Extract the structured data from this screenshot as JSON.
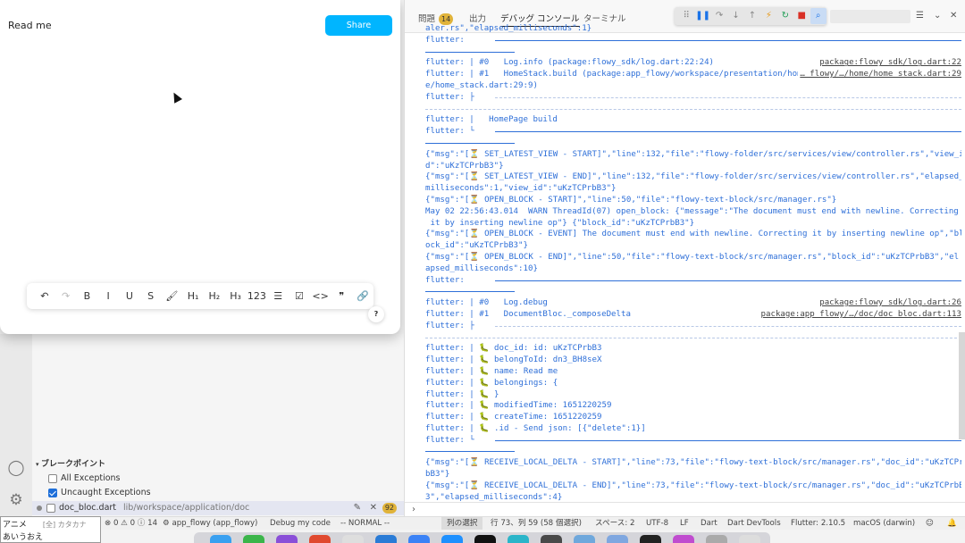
{
  "app_window": {
    "doc_title": "Read me",
    "share_label": "Share",
    "toolbar": {
      "buttons": [
        {
          "name": "undo",
          "glyph": "↶",
          "dim": false
        },
        {
          "name": "redo",
          "glyph": "↷",
          "dim": true
        },
        {
          "name": "bold",
          "glyph": "B",
          "dim": false
        },
        {
          "name": "italic",
          "glyph": "I",
          "dim": false
        },
        {
          "name": "underline",
          "glyph": "U",
          "dim": false
        },
        {
          "name": "strikethrough",
          "glyph": "S",
          "dim": false
        },
        {
          "name": "highlight",
          "glyph": "🖌",
          "dim": false
        },
        {
          "name": "h1",
          "glyph": "H₁",
          "dim": false
        },
        {
          "name": "h2",
          "glyph": "H₂",
          "dim": false
        },
        {
          "name": "h3",
          "glyph": "H₃",
          "dim": false
        },
        {
          "name": "numbered-list",
          "glyph": "123",
          "dim": false
        },
        {
          "name": "bullet-list",
          "glyph": "☰",
          "dim": false
        },
        {
          "name": "checkbox",
          "glyph": "☑",
          "dim": false
        },
        {
          "name": "code",
          "glyph": "<>",
          "dim": false
        },
        {
          "name": "quote",
          "glyph": "❞",
          "dim": false
        },
        {
          "name": "link",
          "glyph": "🔗",
          "dim": true
        }
      ]
    },
    "help_label": "?"
  },
  "panel": {
    "tabs": [
      {
        "label": "問題",
        "active": false
      },
      {
        "label": "出力",
        "active": false
      },
      {
        "label": "デバッグ コンソール",
        "active": true
      },
      {
        "label": "ターミナル",
        "active": false
      }
    ],
    "problems_count": "14",
    "log_lines": [
      {
        "kind": "text",
        "text": "aler.rs\",\"elapsed_milliseconds\":1}"
      },
      {
        "kind": "rule-full",
        "text": "flutter: "
      },
      {
        "kind": "rule-short",
        "text": ""
      },
      {
        "kind": "frame",
        "text": "flutter: | #0   Log.info (package:flowy_sdk/log.dart:22:24)",
        "link": "package:flowy_sdk/log.dart:22"
      },
      {
        "kind": "frame",
        "text": "flutter: | #1   HomeStack.build (package:app_flowy/workspace/presentation/hom",
        "link": "…_flowy/…/home/home_stack.dart:29"
      },
      {
        "kind": "text",
        "text": "e/home_stack.dart:29:9)"
      },
      {
        "kind": "dash",
        "text": "flutter: ├"
      },
      {
        "kind": "dash-only",
        "text": ""
      },
      {
        "kind": "text",
        "text": "flutter: |   HomePage build"
      },
      {
        "kind": "rule-full",
        "text": "flutter: └"
      },
      {
        "kind": "rule-short",
        "text": ""
      },
      {
        "kind": "text",
        "text": "{\"msg\":\"[⏳ SET_LATEST_VIEW - START]\",\"line\":132,\"file\":\"flowy-folder/src/services/view/controller.rs\",\"view_i"
      },
      {
        "kind": "text",
        "text": "d\":\"uKzTCPrbB3\"}"
      },
      {
        "kind": "text",
        "text": "{\"msg\":\"[⏳ SET_LATEST_VIEW - END]\",\"line\":132,\"file\":\"flowy-folder/src/services/view/controller.rs\",\"elapsed_"
      },
      {
        "kind": "text",
        "text": "milliseconds\":1,\"view_id\":\"uKzTCPrbB3\"}"
      },
      {
        "kind": "text",
        "text": "{\"msg\":\"[⏳ OPEN_BLOCK - START]\",\"line\":50,\"file\":\"flowy-text-block/src/manager.rs\"}"
      },
      {
        "kind": "text",
        "text": "May 02 22:56:43.014  WARN ThreadId(07) open_block: {\"message\":\"The document must end with newline. Correcting"
      },
      {
        "kind": "text",
        "text": " it by inserting newline op\"} {\"block_id\":\"uKzTCPrbB3\"}"
      },
      {
        "kind": "text",
        "text": "{\"msg\":\"[⏳ OPEN_BLOCK - EVENT] The document must end with newline. Correcting it by inserting newline op\",\"bl"
      },
      {
        "kind": "text",
        "text": "ock_id\":\"uKzTCPrbB3\"}"
      },
      {
        "kind": "text",
        "text": "{\"msg\":\"[⏳ OPEN_BLOCK - END]\",\"line\":50,\"file\":\"flowy-text-block/src/manager.rs\",\"block_id\":\"uKzTCPrbB3\",\"el"
      },
      {
        "kind": "text",
        "text": "apsed_milliseconds\":10}"
      },
      {
        "kind": "rule-full",
        "text": "flutter: "
      },
      {
        "kind": "rule-short",
        "text": ""
      },
      {
        "kind": "frame",
        "text": "flutter: | #0   Log.debug",
        "link": "package:flowy_sdk/log.dart:26"
      },
      {
        "kind": "frame",
        "text": "flutter: | #1   DocumentBloc._composeDelta",
        "link": "package:app_flowy/…/doc/doc_bloc.dart:113"
      },
      {
        "kind": "dash",
        "text": "flutter: ├"
      },
      {
        "kind": "dash-only",
        "text": ""
      },
      {
        "kind": "text",
        "text": "flutter: | 🐛 doc_id: id: uKzTCPrbB3"
      },
      {
        "kind": "text",
        "text": "flutter: | 🐛 belongToId: dn3_BH8seX"
      },
      {
        "kind": "text",
        "text": "flutter: | 🐛 name: Read me"
      },
      {
        "kind": "text",
        "text": "flutter: | 🐛 belongings: {"
      },
      {
        "kind": "text",
        "text": "flutter: | 🐛 }"
      },
      {
        "kind": "text",
        "text": "flutter: | 🐛 modifiedTime: 1651220259"
      },
      {
        "kind": "text",
        "text": "flutter: | 🐛 createTime: 1651220259"
      },
      {
        "kind": "text",
        "text": "flutter: | 🐛 .id - Send json: [{\"delete\":1}]"
      },
      {
        "kind": "rule-full",
        "text": "flutter: └"
      },
      {
        "kind": "rule-short",
        "text": ""
      },
      {
        "kind": "text",
        "text": "{\"msg\":\"[⏳ RECEIVE_LOCAL_DELTA - START]\",\"line\":73,\"file\":\"flowy-text-block/src/manager.rs\",\"doc_id\":\"uKzTCPr"
      },
      {
        "kind": "text",
        "text": "bB3\"}"
      },
      {
        "kind": "text",
        "text": "{\"msg\":\"[⏳ RECEIVE_LOCAL_DELTA - END]\",\"line\":73,\"file\":\"flowy-text-block/src/manager.rs\",\"doc_id\":\"uKzTCPrbB"
      },
      {
        "kind": "text",
        "text": "3\",\"elapsed_milliseconds\":4}"
      }
    ],
    "input_prompt": "›"
  },
  "side": {
    "breakpoints_header": "ブレークポイント",
    "all_exceptions": "All Exceptions",
    "uncaught_exceptions": "Uncaught Exceptions",
    "file_name": "doc_bloc.dart",
    "file_path": "lib/workspace/application/doc",
    "file_count": "92"
  },
  "ime": {
    "mode_label": "アニメ",
    "mode_sub": "[全] カタカナ",
    "candidate": "あいうおえ"
  },
  "status_bar": {
    "errors": "0",
    "warnings": "0",
    "infos": "14",
    "debug_target": "app_flowy (app_flowy)",
    "debug_my_code": "Debug my code",
    "vim_mode": "-- NORMAL --",
    "selection_mode": "列の選択",
    "position": "行 73、列 59 (58 個選択)",
    "spaces": "スペース: 2",
    "encoding": "UTF-8",
    "eol": "LF",
    "language": "Dart",
    "devtools": "Dart DevTools",
    "flutter_version": "Flutter: 2.10.5",
    "device": "macOS (darwin)"
  },
  "colors": {
    "log_text": "#2e6fd8",
    "share_button": "#00b5ff",
    "badge": "#e0b33a"
  }
}
